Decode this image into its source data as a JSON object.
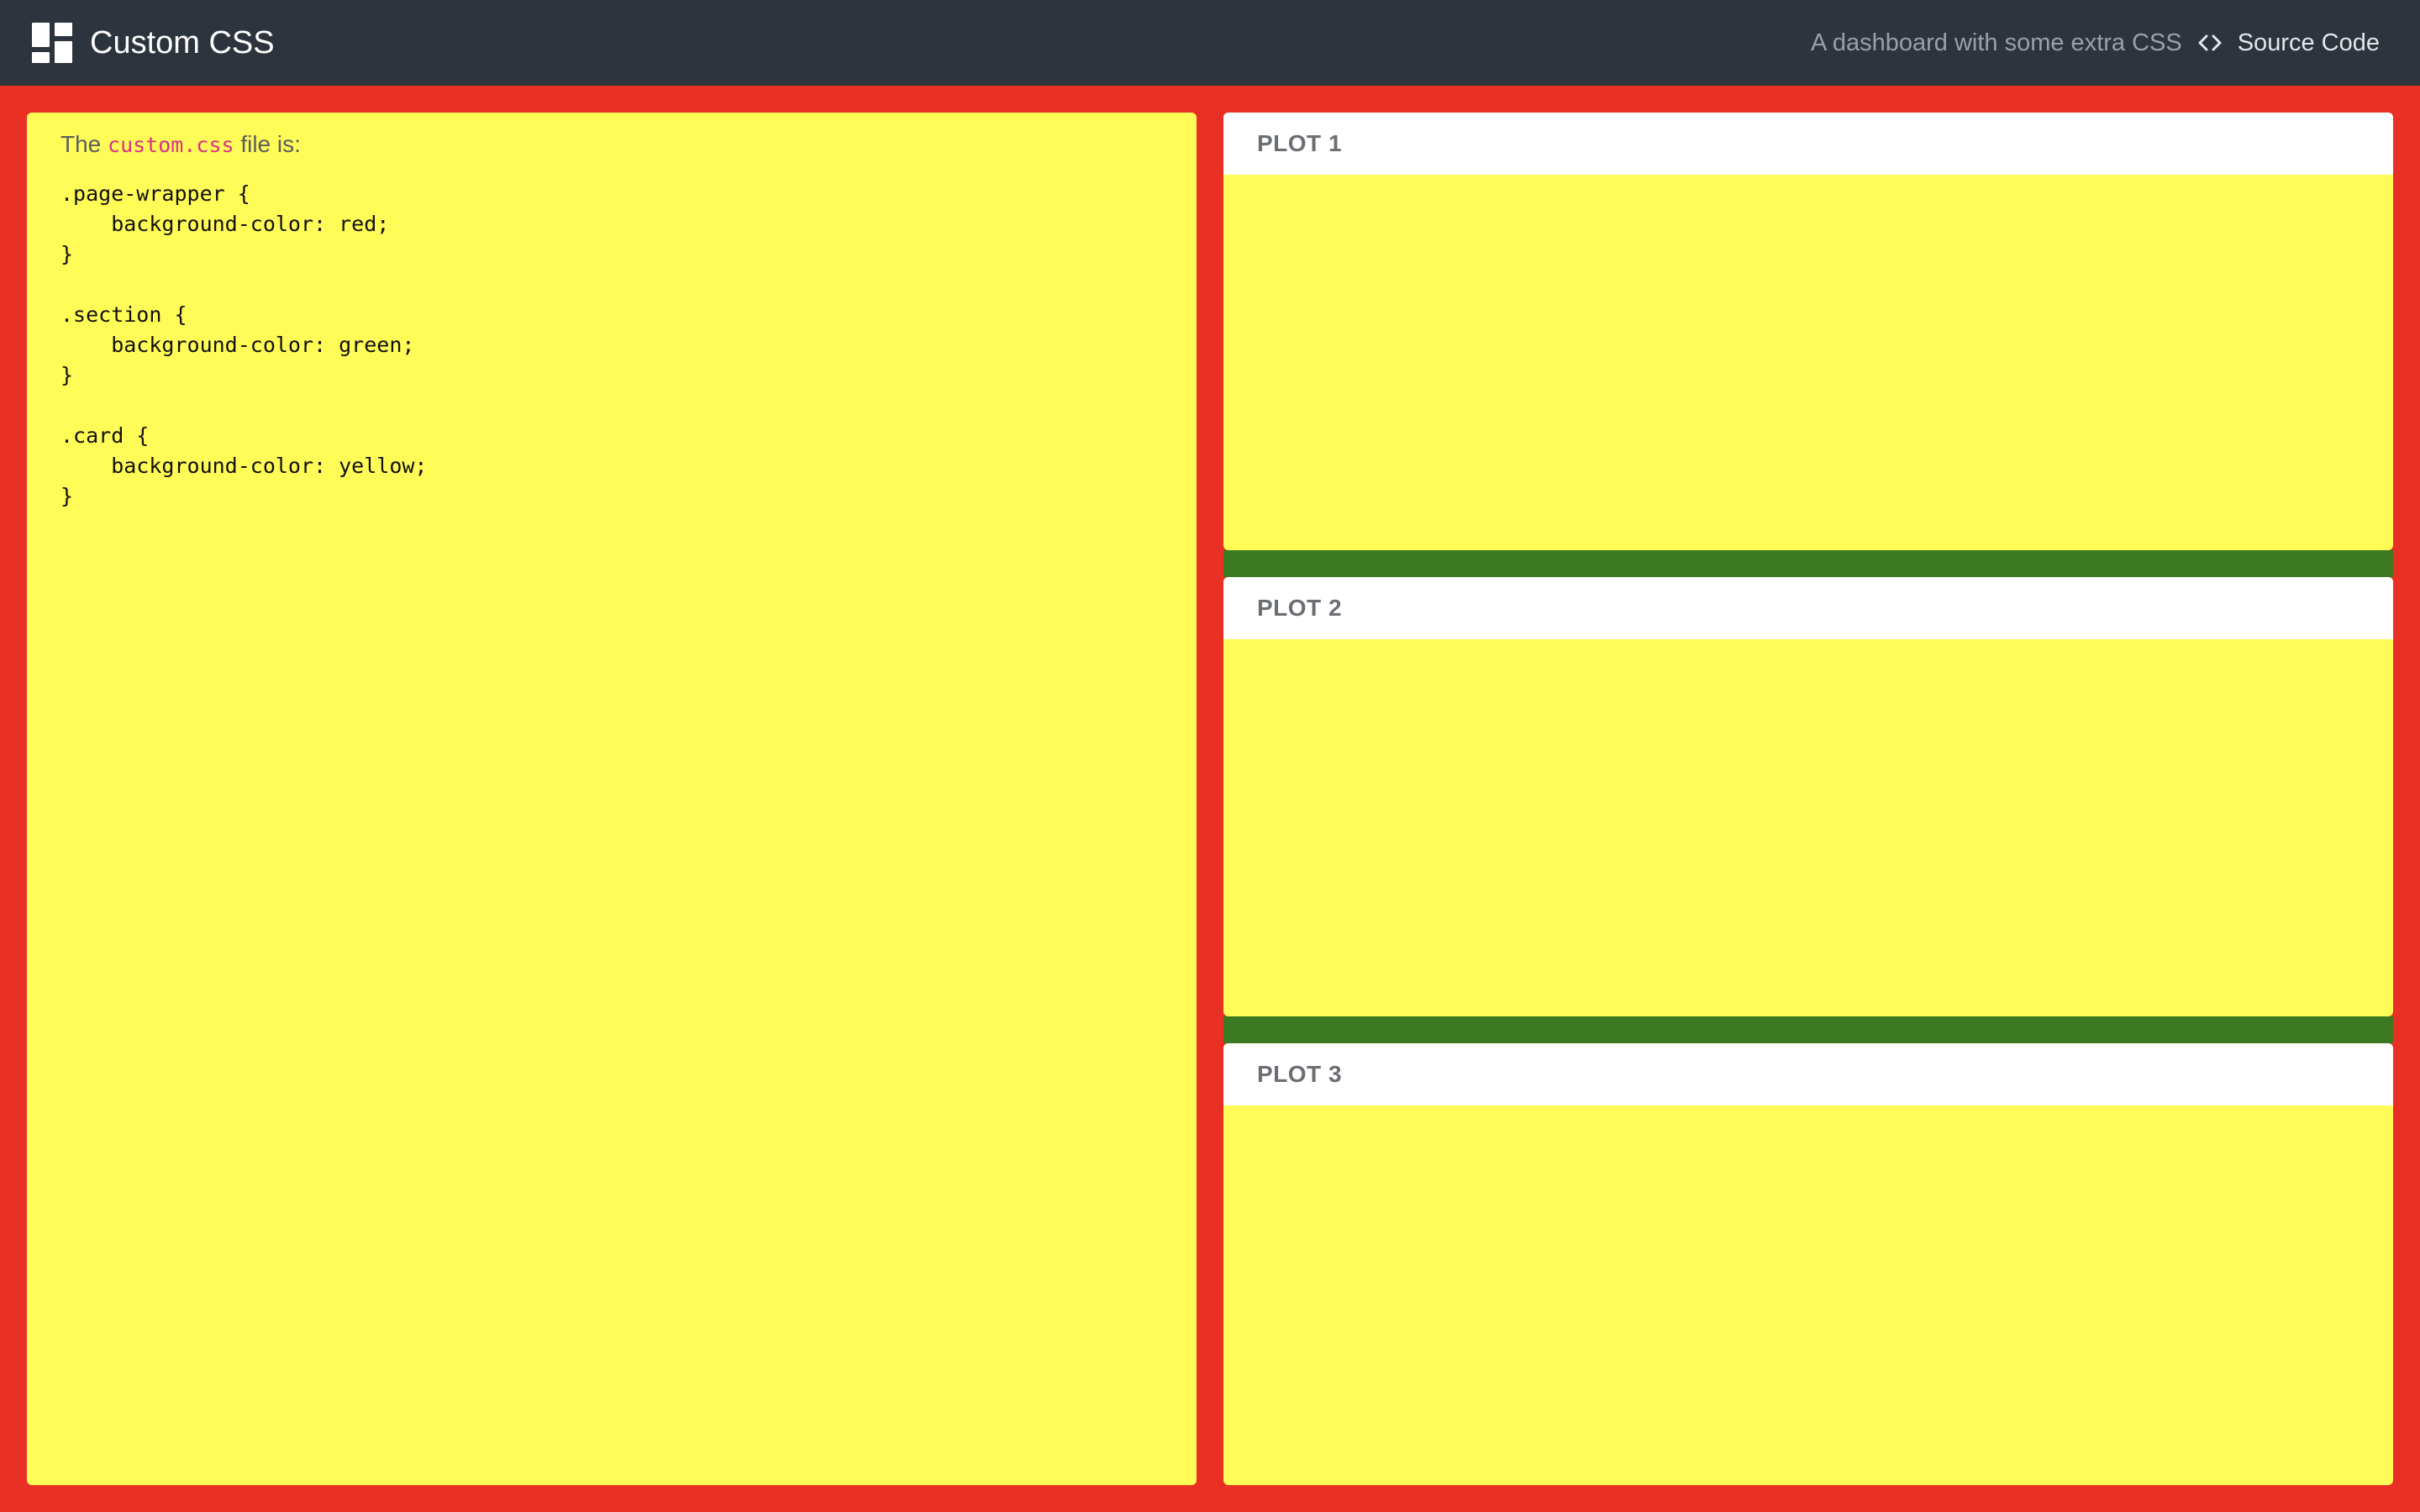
{
  "navbar": {
    "title": "Custom CSS",
    "tagline": "A dashboard with some extra CSS",
    "source_label": "Source Code",
    "brand_icon": "dashboard-icon",
    "source_icon": "code-icon"
  },
  "colors": {
    "navbar": "#2d343d",
    "page_wrapper": "#e83025",
    "section": "#3b7a20",
    "card": "#fffb57",
    "card_header": "#ffffff"
  },
  "left_card": {
    "intro_before": "The",
    "intro_code": "custom.css",
    "intro_after": "file is:",
    "code": ".page-wrapper {\n    background-color: red;\n}\n\n.section {\n    background-color: green;\n}\n\n.card {\n    background-color: yellow;\n}"
  },
  "plots": [
    {
      "title": "PLOT 1"
    },
    {
      "title": "PLOT 2"
    },
    {
      "title": "PLOT 3"
    }
  ]
}
